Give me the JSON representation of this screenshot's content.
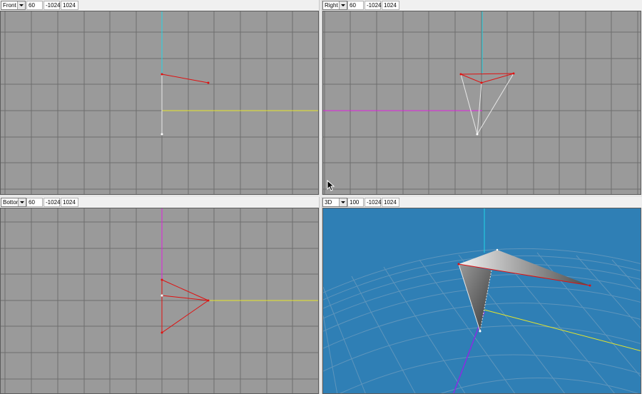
{
  "colors": {
    "ortho_bg": "#9a9a9a",
    "ortho_grid": "#6e6e6e",
    "persp_bg": "#2f7fb5",
    "persp_grid": "#5e95bc",
    "axis_cyan": "#22d6e6",
    "axis_yellow": "#e6e62a",
    "axis_magenta": "#e020e0",
    "axis_violet": "#8a2be2",
    "edge_red": "#e01010",
    "edge_white": "#e8e8e8"
  },
  "viewports": [
    {
      "id": "front",
      "view": "Front",
      "grid": "60",
      "min": "-1024",
      "max": "1024"
    },
    {
      "id": "right",
      "view": "Right",
      "grid": "60",
      "min": "-1024",
      "max": "1024"
    },
    {
      "id": "bottom",
      "view": "Bottom",
      "grid": "60",
      "min": "-1024",
      "max": "1024"
    },
    {
      "id": "persp",
      "view": "3D",
      "grid": "100",
      "min": "-1024",
      "max": "1024"
    }
  ],
  "icons": {
    "cursor": "arrow-cursor-icon",
    "dropdown": "chevron-down-icon"
  }
}
